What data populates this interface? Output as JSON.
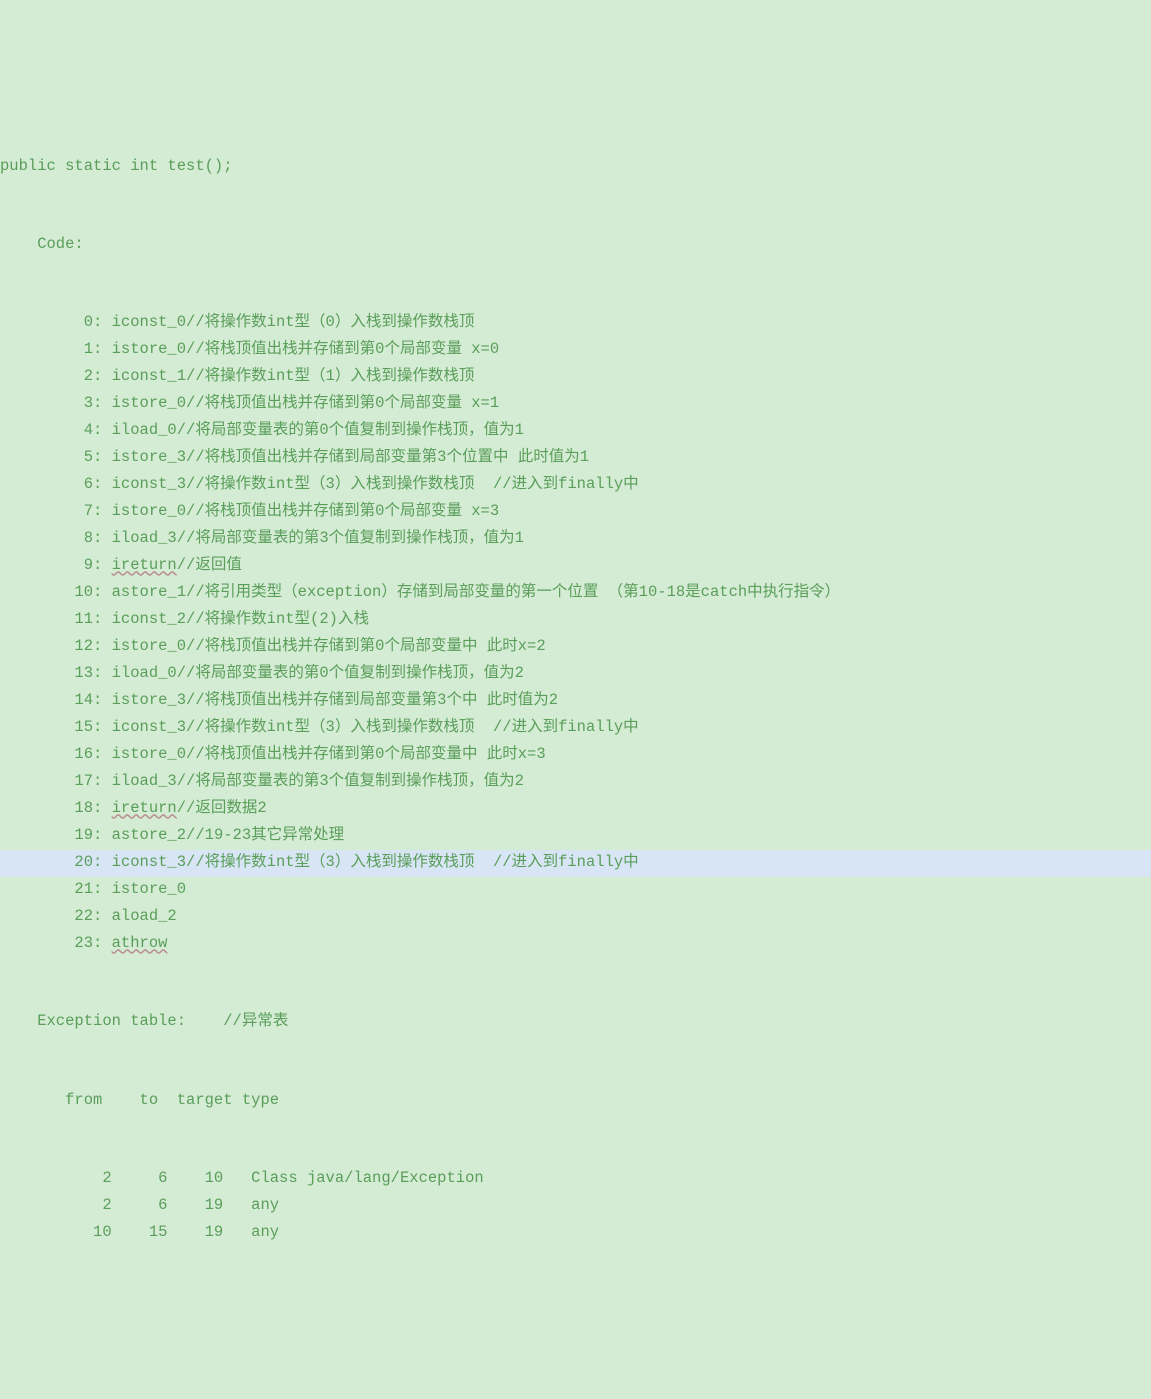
{
  "signature": "public static int test();",
  "code_label": "    Code:",
  "lines": [
    {
      "idx": "0",
      "op": "iconst_0",
      "pad": "     ",
      "comment": "//将操作数int型（0）入栈到操作数栈顶",
      "underline": false
    },
    {
      "idx": "1",
      "op": "istore_0",
      "pad": "     ",
      "comment": "//将栈顶值出栈并存储到第0个局部变量 x=0",
      "underline": false
    },
    {
      "idx": "2",
      "op": "iconst_1",
      "pad": "     ",
      "comment": "//将操作数int型（1）入栈到操作数栈顶",
      "underline": false
    },
    {
      "idx": "3",
      "op": "istore_0",
      "pad": "     ",
      "comment": "//将栈顶值出栈并存储到第0个局部变量 x=1",
      "underline": false
    },
    {
      "idx": "4",
      "op": "iload_0",
      "pad": "      ",
      "comment": "//将局部变量表的第0个值复制到操作栈顶，值为1",
      "underline": false
    },
    {
      "idx": "5",
      "op": "istore_3",
      "pad": "     ",
      "comment": "//将栈顶值出栈并存储到局部变量第3个位置中 此时值为1",
      "underline": false
    },
    {
      "idx": "6",
      "op": "iconst_3",
      "pad": "     ",
      "comment": "//将操作数int型（3）入栈到操作数栈顶  //进入到finally中",
      "underline": false
    },
    {
      "idx": "7",
      "op": "istore_0",
      "pad": "     ",
      "comment": "//将栈顶值出栈并存储到第0个局部变量 x=3",
      "underline": false
    },
    {
      "idx": "8",
      "op": "iload_3",
      "pad": "      ",
      "comment": "//将局部变量表的第3个值复制到操作栈顶，值为1",
      "underline": false
    },
    {
      "idx": "9",
      "op": "ireturn",
      "pad": "      ",
      "comment": "//返回值",
      "underline": true
    },
    {
      "idx": "10",
      "op": "astore_1",
      "pad": "     ",
      "comment": "//将引用类型（exception）存储到局部变量的第一个位置 （第10-18是catch中执行指令）",
      "underline": false
    },
    {
      "idx": "11",
      "op": "iconst_2",
      "pad": "      ",
      "comment": "//将操作数int型(2)入栈",
      "underline": false
    },
    {
      "idx": "12",
      "op": "istore_0",
      "pad": "      ",
      "comment": "//将栈顶值出栈并存储到第0个局部变量中 此时x=2",
      "underline": false
    },
    {
      "idx": "13",
      "op": "iload_0",
      "pad": "       ",
      "comment": "//将局部变量表的第0个值复制到操作栈顶，值为2",
      "underline": false
    },
    {
      "idx": "14",
      "op": "istore_3",
      "pad": "      ",
      "comment": "//将栈顶值出栈并存储到局部变量第3个中 此时值为2",
      "underline": false
    },
    {
      "idx": "15",
      "op": "iconst_3",
      "pad": "      ",
      "comment": "//将操作数int型（3）入栈到操作数栈顶  //进入到finally中",
      "underline": false
    },
    {
      "idx": "16",
      "op": "istore_0",
      "pad": "      ",
      "comment": "//将栈顶值出栈并存储到第0个局部变量中 此时x=3",
      "underline": false
    },
    {
      "idx": "17",
      "op": "iload_3",
      "pad": "       ",
      "comment": "//将局部变量表的第3个值复制到操作栈顶，值为2",
      "underline": false
    },
    {
      "idx": "18",
      "op": "ireturn",
      "pad": "       ",
      "comment": "//返回数据2",
      "underline": true
    },
    {
      "idx": "19",
      "op": "astore_2",
      "pad": "      ",
      "comment": "//19-23其它异常处理",
      "underline": false
    },
    {
      "idx": "20",
      "op": "iconst_3",
      "pad": "      ",
      "comment": "//将操作数int型（3）入栈到操作数栈顶  //进入到finally中",
      "underline": false,
      "highlight": true
    },
    {
      "idx": "21",
      "op": "istore_0",
      "pad": "",
      "comment": "",
      "underline": false
    },
    {
      "idx": "22",
      "op": "aload_2",
      "pad": "",
      "comment": "",
      "underline": false
    },
    {
      "idx": "23",
      "op": "athrow",
      "pad": "",
      "comment": "",
      "underline": true
    }
  ],
  "exception_table_label": "    Exception table:    //异常表",
  "exception_header": "       from    to  target type",
  "exception_rows": [
    "           2     6    10   Class java/lang/Exception",
    "           2     6    19   any",
    "          10    15    19   any"
  ]
}
